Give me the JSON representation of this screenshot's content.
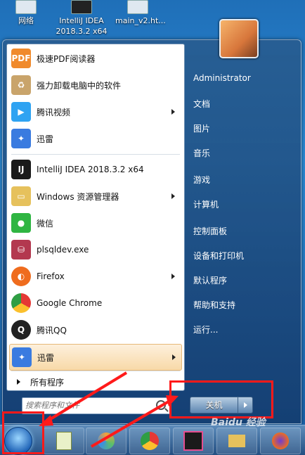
{
  "desktop": {
    "icons": [
      {
        "label": "网络"
      },
      {
        "label": "IntelliJ IDEA 2018.3.2 x64"
      },
      {
        "label": "main_v2.ht..."
      }
    ]
  },
  "start_menu": {
    "programs": [
      {
        "label": "极速PDF阅读器",
        "icon": "pdf-reader-icon",
        "color": "#f08a2c",
        "submenu": false
      },
      {
        "label": "强力卸载电脑中的软件",
        "icon": "uninstall-icon",
        "color": "#c9a46b",
        "submenu": false
      },
      {
        "label": "腾讯视频",
        "icon": "tencent-video-icon",
        "color": "#2fa3f2",
        "submenu": true
      },
      {
        "label": "迅雷",
        "icon": "xunlei-icon",
        "color": "#3a7be0",
        "submenu": false
      },
      {
        "label": "IntelliJ IDEA 2018.3.2 x64",
        "icon": "intellij-icon",
        "color": "#1a1a1a",
        "submenu": false
      },
      {
        "label": "Windows 资源管理器",
        "icon": "explorer-icon",
        "color": "#e6c15c",
        "submenu": true
      },
      {
        "label": "微信",
        "icon": "wechat-icon",
        "color": "#2fb542",
        "submenu": false
      },
      {
        "label": "plsqldev.exe",
        "icon": "plsqldev-icon",
        "color": "#b3384f",
        "submenu": false
      },
      {
        "label": "Firefox",
        "icon": "firefox-icon",
        "color": "#ef6c1e",
        "submenu": true
      },
      {
        "label": "Google Chrome",
        "icon": "chrome-icon",
        "color": "#2f9e44",
        "submenu": false
      },
      {
        "label": "腾讯QQ",
        "icon": "qq-icon",
        "color": "#222222",
        "submenu": false
      },
      {
        "label": "迅雷",
        "icon": "xunlei-icon",
        "color": "#3a7be0",
        "submenu": true
      }
    ],
    "all_programs_label": "所有程序",
    "search_placeholder": "搜索程序和文件",
    "right_links": [
      {
        "label": "Administrator"
      },
      {
        "label": "文档"
      },
      {
        "label": "图片"
      },
      {
        "label": "音乐"
      },
      {
        "label": "游戏"
      },
      {
        "label": "计算机"
      },
      {
        "label": "控制面板"
      },
      {
        "label": "设备和打印机"
      },
      {
        "label": "默认程序"
      },
      {
        "label": "帮助和支持"
      },
      {
        "label": "运行..."
      }
    ],
    "shutdown_label": "关机"
  },
  "watermark": "Baidu 经验",
  "colors": {
    "highlight": "#f8d9a8",
    "annotation": "#ff1a1a"
  }
}
